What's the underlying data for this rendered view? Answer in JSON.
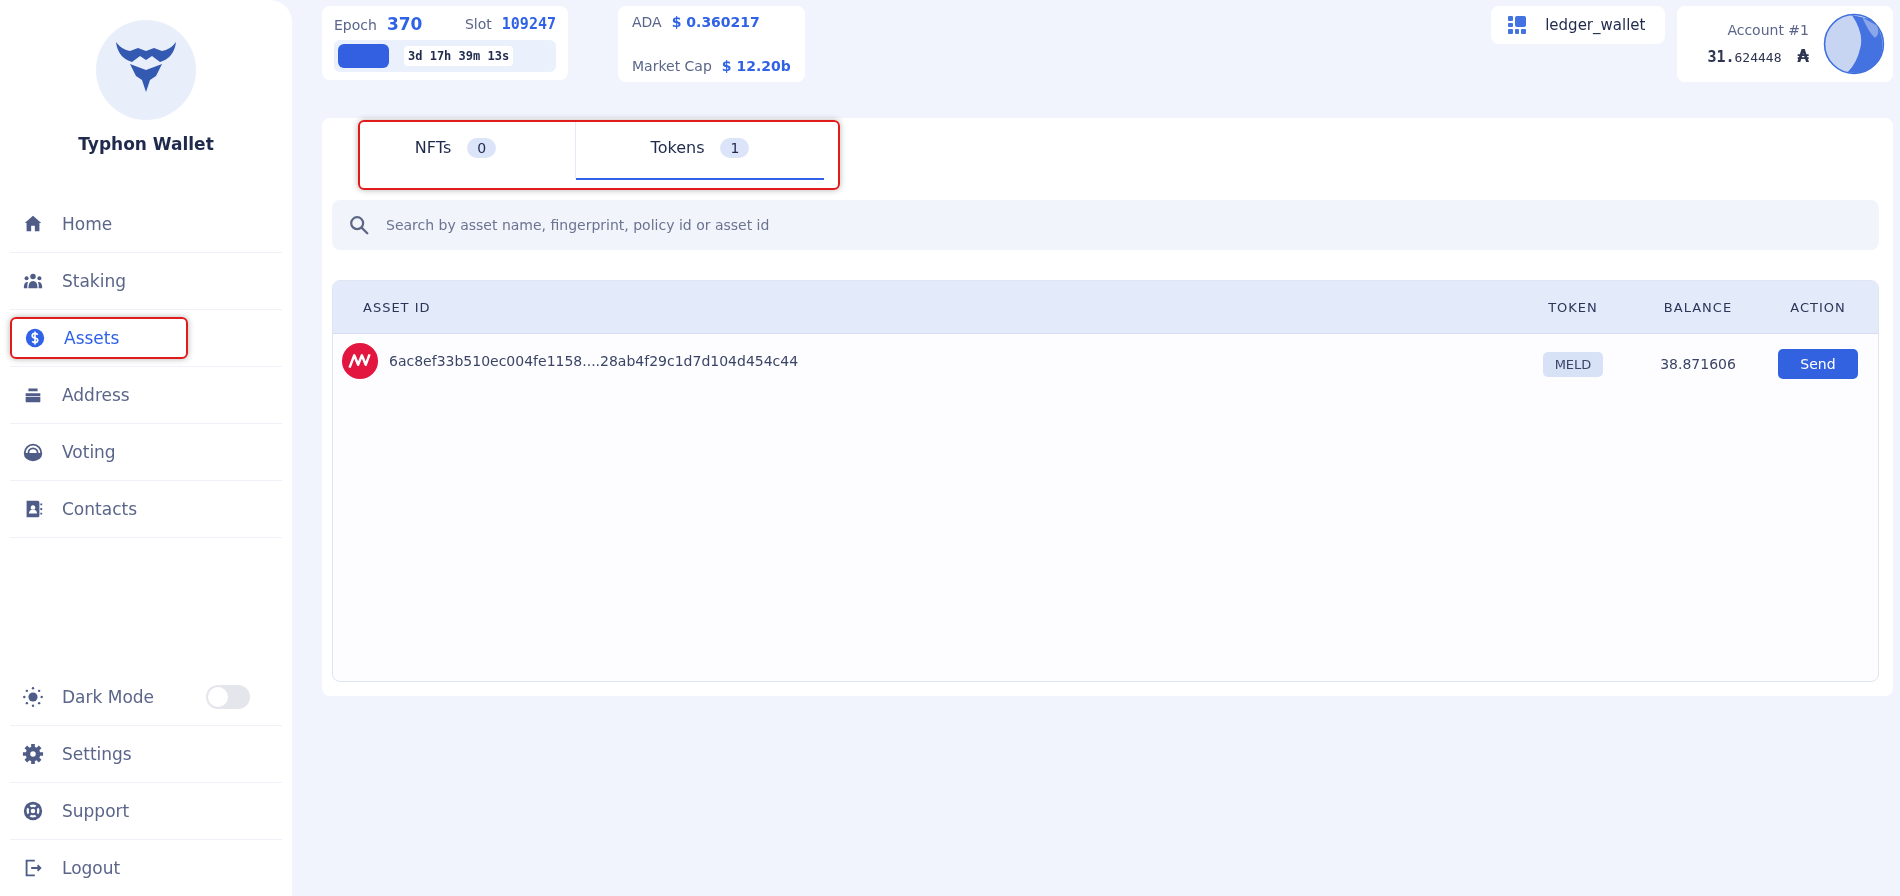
{
  "sidebar": {
    "title": "Typhon Wallet",
    "nav": [
      {
        "label": "Home",
        "selected": false,
        "highlighted": false
      },
      {
        "label": "Staking",
        "selected": false,
        "highlighted": false
      },
      {
        "label": "Assets",
        "selected": true,
        "highlighted": true
      },
      {
        "label": "Address",
        "selected": false,
        "highlighted": false
      },
      {
        "label": "Voting",
        "selected": false,
        "highlighted": false
      },
      {
        "label": "Contacts",
        "selected": false,
        "highlighted": false
      }
    ],
    "bottom": [
      {
        "kind": "toggle",
        "label": "Dark Mode",
        "on": false
      },
      {
        "kind": "link",
        "label": "Settings"
      },
      {
        "kind": "link",
        "label": "Support"
      },
      {
        "kind": "link",
        "label": "Logout"
      }
    ]
  },
  "epoch": {
    "epoch_label": "Epoch",
    "epoch": "370",
    "slot_label": "Slot",
    "slot": "109247",
    "level": 0.24,
    "remaining": "3d 17h 39m 13s"
  },
  "price": {
    "ada_label": "ADA",
    "ada": "$ 0.360217",
    "cap_label": "Market Cap",
    "cap": "$ 12.20b"
  },
  "wallet": {
    "name": "ledger_wallet"
  },
  "account": {
    "name": "Account #1",
    "balance_int": "31.",
    "balance_dec": "624448",
    "unit": "₳"
  },
  "tabs": {
    "highlighted": true,
    "items": [
      {
        "label": "NFTs",
        "count": "0",
        "selected": false
      },
      {
        "label": "Tokens",
        "count": "1",
        "selected": true
      }
    ]
  },
  "search": {
    "placeholder": "Search by asset name, fingerprint, policy id or asset id"
  },
  "table": {
    "columns": [
      "ASSET ID",
      "TOKEN",
      "BALANCE",
      "ACTION"
    ],
    "rows": [
      {
        "asset_id": "6ac8ef33b510ec004fe1158....28ab4f29c1d7d104d454c44",
        "token": "MELD",
        "balance": "38.871606",
        "action": "Send"
      }
    ]
  }
}
